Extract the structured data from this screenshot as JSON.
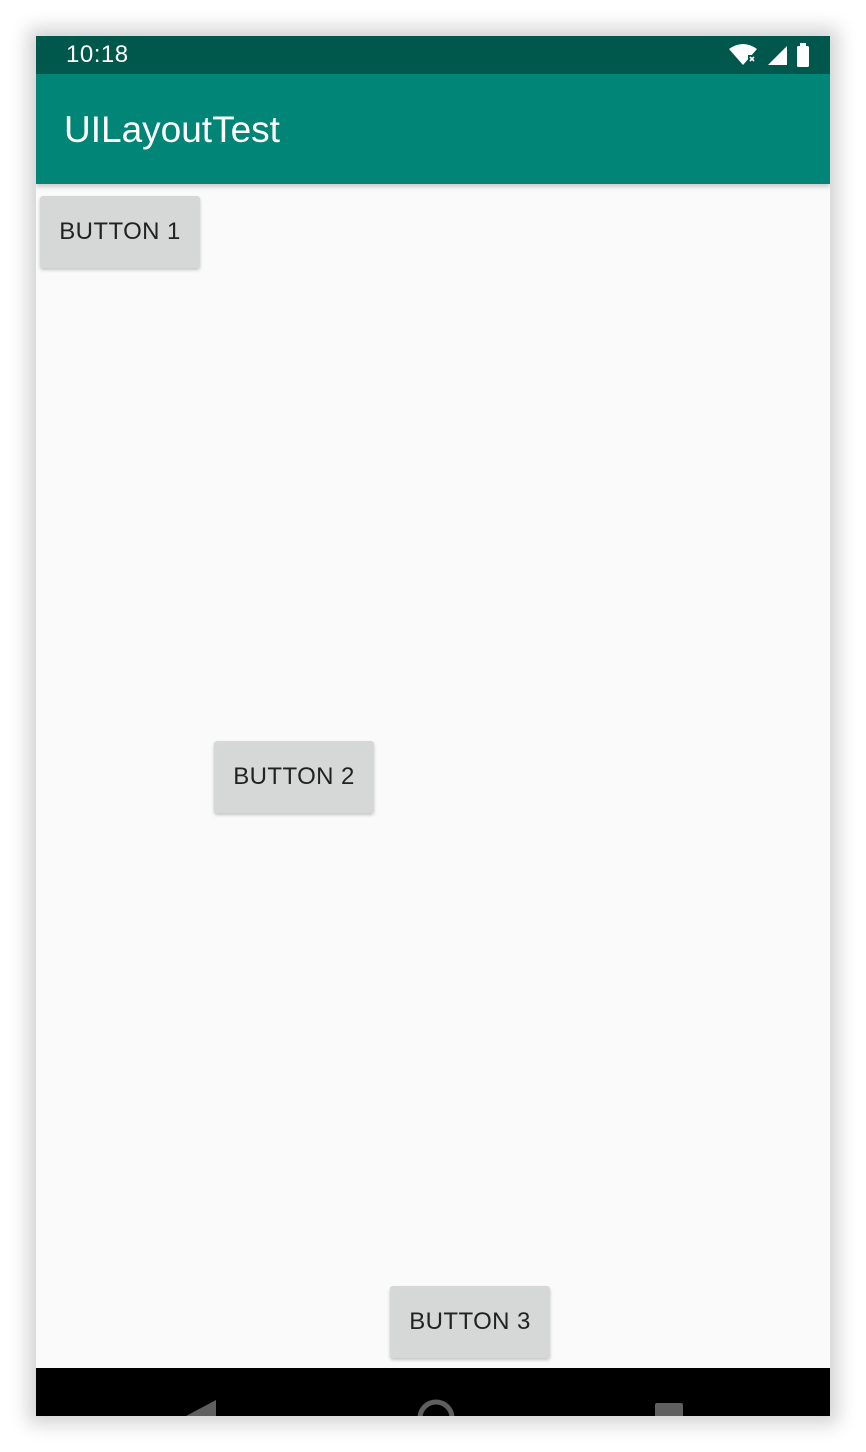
{
  "status_bar": {
    "time": "10:18",
    "icons": [
      "wifi-icon",
      "cell-signal-icon",
      "battery-icon"
    ],
    "color": "#00574b"
  },
  "app_bar": {
    "title": "UILayoutTest",
    "color": "#008577"
  },
  "buttons": [
    {
      "label": "BUTTON 1"
    },
    {
      "label": "BUTTON 2"
    },
    {
      "label": "BUTTON 3"
    }
  ],
  "nav_bar": {
    "icons": [
      "back-icon",
      "home-icon",
      "recents-icon"
    ]
  }
}
